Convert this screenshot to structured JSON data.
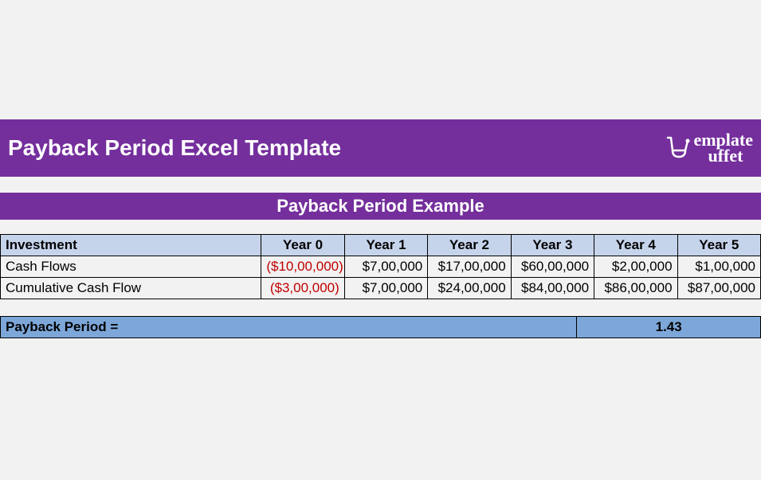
{
  "header": {
    "title": "Payback Period Excel Template",
    "logo_text": "emplate uffet"
  },
  "subtitle": "Payback Period Example",
  "table": {
    "row_header": "Investment",
    "year_headers": [
      "Year 0",
      "Year 1",
      "Year 2",
      "Year 3",
      "Year 4",
      "Year 5"
    ],
    "rows": [
      {
        "label": "Cash Flows",
        "values": [
          "($10,00,000)",
          "$7,00,000",
          "$17,00,000",
          "$60,00,000",
          "$2,00,000",
          "$1,00,000"
        ],
        "neg_flags": [
          true,
          false,
          false,
          false,
          false,
          false
        ]
      },
      {
        "label": "Cumulative Cash Flow",
        "values": [
          "($3,00,000)",
          "$7,00,000",
          "$24,00,000",
          "$84,00,000",
          "$86,00,000",
          "$87,00,000"
        ],
        "neg_flags": [
          true,
          false,
          false,
          false,
          false,
          false
        ]
      }
    ]
  },
  "result": {
    "label": "Payback Period =",
    "value": "1.43"
  },
  "chart_data": {
    "type": "table",
    "title": "Payback Period Example",
    "columns": [
      "Year 0",
      "Year 1",
      "Year 2",
      "Year 3",
      "Year 4",
      "Year 5"
    ],
    "series": [
      {
        "name": "Cash Flows",
        "values": [
          -1000000,
          700000,
          1700000,
          6000000,
          200000,
          100000
        ]
      },
      {
        "name": "Cumulative Cash Flow",
        "values": [
          -300000,
          700000,
          2400000,
          8400000,
          8600000,
          8700000
        ]
      }
    ],
    "payback_period": 1.43
  }
}
